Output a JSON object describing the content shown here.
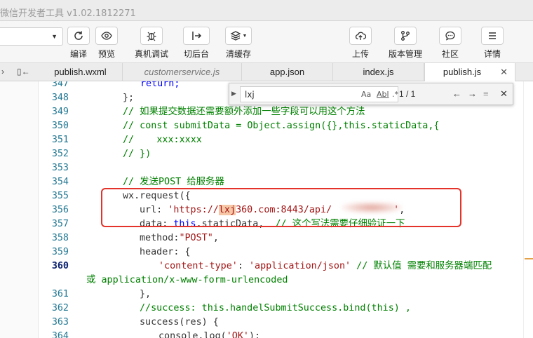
{
  "window": {
    "title": "微信开发者工具 v1.02.1812271"
  },
  "toolbar": {
    "buttons": [
      {
        "id": "compile",
        "label": "编译"
      },
      {
        "id": "preview",
        "label": "预览"
      },
      {
        "id": "realdebug",
        "label": "真机调试"
      },
      {
        "id": "background",
        "label": "切后台"
      },
      {
        "id": "clearcache",
        "label": "清缓存"
      },
      {
        "id": "upload",
        "label": "上传"
      },
      {
        "id": "version",
        "label": "版本管理"
      },
      {
        "id": "community",
        "label": "社区"
      },
      {
        "id": "details",
        "label": "详情"
      }
    ]
  },
  "tabs": [
    {
      "label": "publish.wxml"
    },
    {
      "label": "customerservice.js"
    },
    {
      "label": "app.json"
    },
    {
      "label": "index.js"
    },
    {
      "label": "publish.js",
      "close": "✕"
    }
  ],
  "find": {
    "query": "lxj",
    "opt_case": "Aa",
    "opt_word": "Abl",
    "opt_regex": ".*",
    "count": "1 / 1"
  },
  "editor": {
    "line_numbers": [
      "347",
      "348",
      "349",
      "350",
      "351",
      "352",
      "353",
      "354",
      "355",
      "356",
      "357",
      "358",
      "359",
      "360",
      "361",
      "362",
      "363",
      "364"
    ],
    "code": {
      "l347": "return;",
      "l348": "};",
      "l349": "// 如果提交数据还需要额外添加一些字段可以用这个方法",
      "l350": "// const submitData = Object.assign({},this.staticData,{",
      "l351": "//    xxx:xxxx",
      "l352": "// })",
      "l354": "// 发送POST 给服务器",
      "l355": "wx.request({",
      "l356_a": "url: ",
      "l356_b": "'https://",
      "l356_hl": "lxj",
      "l356_c": "360.com:8443/api/",
      "l356_d": "'",
      "l356_e": ",",
      "l357_a": "data: ",
      "l357_b": "this",
      "l357_c": ".staticData,  ",
      "l357_d": "// 这个写法需要仔细验证一下",
      "l358_a": "method:",
      "l358_b": "\"POST\"",
      "l358_c": ",",
      "l359": "header: {",
      "l360_a": "'content-type'",
      "l360_b": ": ",
      "l360_c": "'application/json'",
      "l360_d": " // 默认值 需要和服务器端匹配",
      "l360_wrap": "或 application/x-www-form-urlencoded",
      "l361": "},",
      "l362": "//success: this.handelSubmitSuccess.bind(this) ,",
      "l363": "success(res) {",
      "l364_a": "console.log(",
      "l364_b": "'OK'",
      "l364_c": ");"
    }
  }
}
